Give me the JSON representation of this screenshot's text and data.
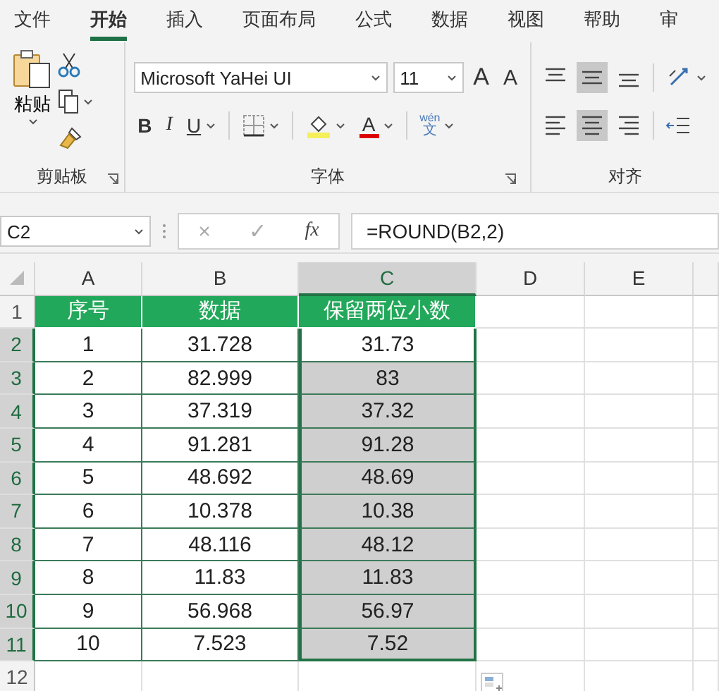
{
  "menu_tabs": [
    {
      "label": "文件",
      "selected": false
    },
    {
      "label": "开始",
      "selected": true
    },
    {
      "label": "插入",
      "selected": false
    },
    {
      "label": "页面布局",
      "selected": false
    },
    {
      "label": "公式",
      "selected": false
    },
    {
      "label": "数据",
      "selected": false
    },
    {
      "label": "视图",
      "selected": false
    },
    {
      "label": "帮助",
      "selected": false
    },
    {
      "label": "审",
      "selected": false
    }
  ],
  "clipboard": {
    "paste_label": "粘贴",
    "group_label": "剪贴板"
  },
  "font": {
    "font_name": "Microsoft YaHei UI",
    "font_size": "11",
    "grow_label": "A",
    "shrink_label": "A",
    "bold": "B",
    "italic": "I",
    "underline": "U",
    "font_color_label": "A",
    "phonetic_top": "wén",
    "phonetic_bottom": "文",
    "group_label": "字体"
  },
  "alignment": {
    "top_buttons": [
      {
        "kind": "top",
        "selected": false
      },
      {
        "kind": "middle",
        "selected": true
      },
      {
        "kind": "bottom",
        "selected": false
      }
    ],
    "bottom_buttons": [
      {
        "kind": "left",
        "selected": false
      },
      {
        "kind": "center",
        "selected": true
      },
      {
        "kind": "right",
        "selected": false
      }
    ],
    "group_label": "对齐"
  },
  "formula_bar": {
    "name_box": "C2",
    "cancel": "×",
    "enter": "✓",
    "fx": "fx",
    "formula": "=ROUND(B2,2)"
  },
  "sheet": {
    "columns": [
      {
        "label": "A",
        "selected": false
      },
      {
        "label": "B",
        "selected": false
      },
      {
        "label": "C",
        "selected": true
      },
      {
        "label": "D",
        "selected": false
      },
      {
        "label": "E",
        "selected": false
      }
    ],
    "rows": [
      {
        "number": "1",
        "kind": "header",
        "selected": false,
        "cells": [
          "序号",
          "数据",
          "保留两位小数"
        ]
      },
      {
        "number": "2",
        "kind": "data",
        "selected": true,
        "cells": [
          "1",
          "31.728",
          "31.73"
        ]
      },
      {
        "number": "3",
        "kind": "data",
        "selected": true,
        "cells": [
          "2",
          "82.999",
          "83"
        ]
      },
      {
        "number": "4",
        "kind": "data",
        "selected": true,
        "cells": [
          "3",
          "37.319",
          "37.32"
        ]
      },
      {
        "number": "5",
        "kind": "data",
        "selected": true,
        "cells": [
          "4",
          "91.281",
          "91.28"
        ]
      },
      {
        "number": "6",
        "kind": "data",
        "selected": true,
        "cells": [
          "5",
          "48.692",
          "48.69"
        ]
      },
      {
        "number": "7",
        "kind": "data",
        "selected": true,
        "cells": [
          "6",
          "10.378",
          "10.38"
        ]
      },
      {
        "number": "8",
        "kind": "data",
        "selected": true,
        "cells": [
          "7",
          "48.116",
          "48.12"
        ]
      },
      {
        "number": "9",
        "kind": "data",
        "selected": true,
        "cells": [
          "8",
          "11.83",
          "11.83"
        ]
      },
      {
        "number": "10",
        "kind": "data",
        "selected": true,
        "cells": [
          "9",
          "56.968",
          "56.97"
        ]
      },
      {
        "number": "11",
        "kind": "data",
        "selected": true,
        "cells": [
          "10",
          "7.523",
          "7.52"
        ]
      },
      {
        "number": "12",
        "kind": "empty",
        "selected": false,
        "cells": []
      }
    ]
  }
}
